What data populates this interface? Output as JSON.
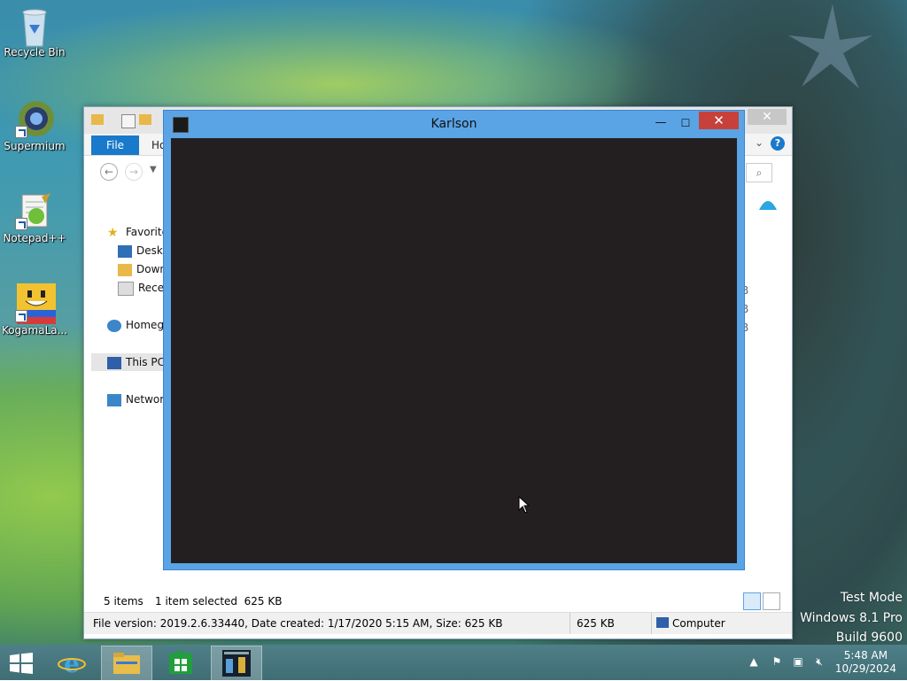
{
  "desktop": {
    "icons": [
      {
        "label": "Recycle Bin",
        "icon": "recycle-bin-icon"
      },
      {
        "label": "Supermium",
        "icon": "supermium-icon"
      },
      {
        "label": "Notepad++",
        "icon": "notepadpp-icon"
      },
      {
        "label": "KogamaLa...",
        "icon": "kogama-icon"
      }
    ],
    "watermark": {
      "line1": "Test Mode",
      "line2": "Windows 8.1 Pro",
      "line3": "Build 9600"
    }
  },
  "explorer": {
    "ribbon": {
      "file_tab": "File",
      "home_tab": "Ho"
    },
    "sidebar": [
      {
        "label": "Favorite",
        "icon": "star-icon"
      },
      {
        "label": "Deskt",
        "icon": "desktop-icon"
      },
      {
        "label": "Down",
        "icon": "downloads-icon"
      },
      {
        "label": "Recen",
        "icon": "recent-icon"
      },
      {
        "label": "Homeg",
        "icon": "homegroup-icon"
      },
      {
        "label": "This PC",
        "icon": "computer-icon"
      },
      {
        "label": "Networ",
        "icon": "network-icon"
      }
    ],
    "right_column": [
      "B",
      "B",
      "B"
    ],
    "status": {
      "items": "5 items",
      "selected": "1 item selected  625 KB"
    },
    "bottom_bar": {
      "file_info": "File version: 2019.2.6.33440, Date created: 1/17/2020 5:15 AM, Size: 625 KB",
      "size": "625 KB",
      "location": "Computer"
    }
  },
  "karlson": {
    "title": "Karlson",
    "client_color": "#231f20"
  },
  "taskbar": {
    "items": [
      "start-icon",
      "internet-explorer-icon",
      "file-explorer-icon",
      "store-icon",
      "karlson-app-icon"
    ],
    "clock": {
      "time": "5:48 AM",
      "date": "10/29/2024"
    }
  },
  "colors": {
    "titlebar_active": "#5aa4e6",
    "close_red": "#c7413a",
    "file_tab_blue": "#1979ca"
  }
}
